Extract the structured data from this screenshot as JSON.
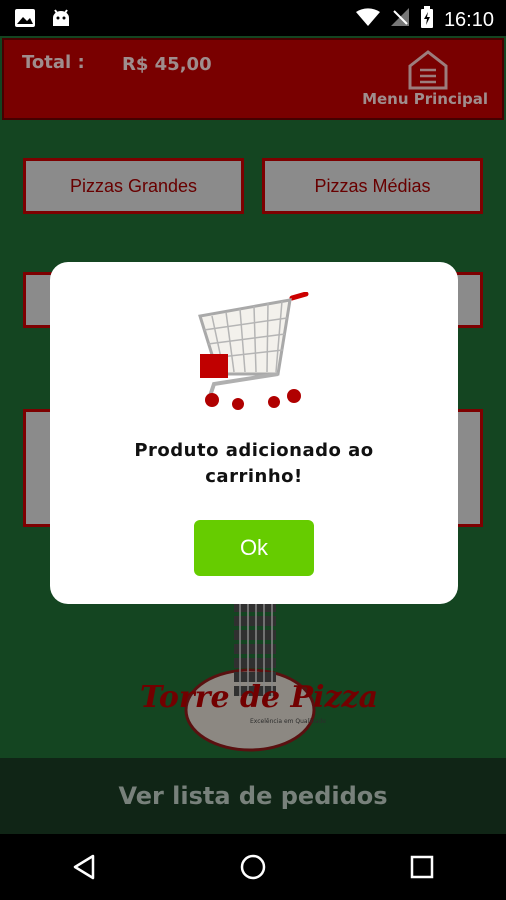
{
  "status_bar": {
    "time": "16:10"
  },
  "header": {
    "total_label": "Total :",
    "total_value": "R$ 45,00",
    "menu_label": "Menu Principal"
  },
  "categories": [
    {
      "label": "Pizzas Grandes"
    },
    {
      "label": "Pizzas Médias"
    }
  ],
  "logo": {
    "text": "Torre de Pizza",
    "tagline": "Excelência em Qualidade"
  },
  "footer": {
    "label": "Ver lista de pedidos"
  },
  "dialog": {
    "message_line1": "Produto adicionado ao",
    "message_line2": "carrinho!",
    "ok_label": "Ok"
  },
  "colors": {
    "app_bg": "#1f6b33",
    "header_bg": "#bb0000",
    "ok_button": "#66cc00",
    "footer_bg": "#193a23"
  }
}
